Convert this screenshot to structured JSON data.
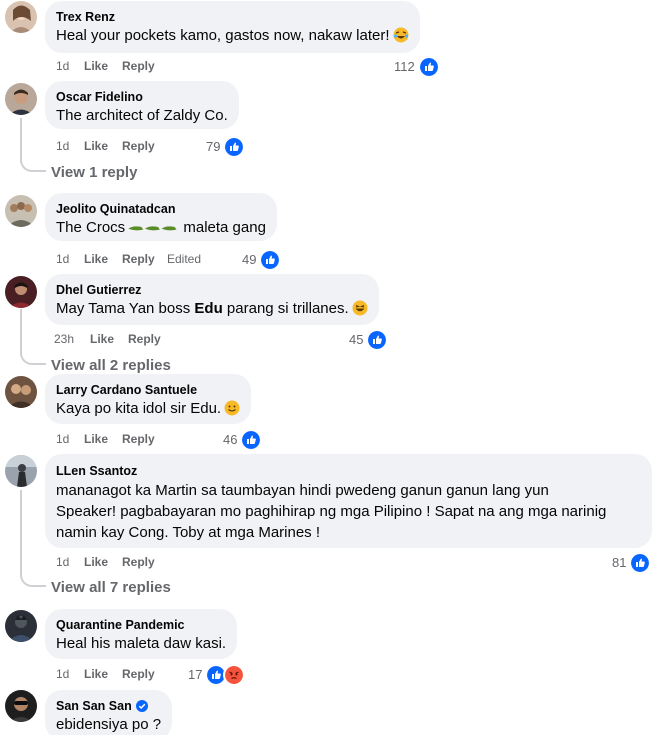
{
  "icons": {
    "like": "like-icon",
    "angry": "angry-icon",
    "verified": "verified-badge-icon"
  },
  "colors": {
    "like_blue": "#0866ff",
    "angry": "#f5533d",
    "bubble": "#f0f2f5",
    "meta_text": "#65676b"
  },
  "actions_labels": {
    "like": "Like",
    "reply": "Reply",
    "edited": "Edited"
  },
  "comments": [
    {
      "author": "Trex Renz",
      "text": "Heal your pockets kamo, gastos now, nakaw later!",
      "emoji": "rofl",
      "time": "1d",
      "reactions": "112"
    },
    {
      "author": "Oscar Fidelino",
      "text": "The architect of Zaldy Co.",
      "time": "1d",
      "reactions": "79",
      "view_replies": "View 1 reply"
    },
    {
      "author": "Jeolito Quinatadcan",
      "text_before": "The Crocs",
      "text_after": " maleta gang",
      "time": "1d",
      "reactions": "49",
      "edited": true
    },
    {
      "author": "Dhel Gutierrez",
      "text_before": "May Tama Yan boss ",
      "text_bold": "Edu",
      "text_after": " parang si trillanes.",
      "emoji": "laugh",
      "time": "23h",
      "reactions": "45",
      "view_replies": "View all 2 replies"
    },
    {
      "author": "Larry Cardano Santuele",
      "text": "Kaya po kita idol sir Edu.",
      "emoji": "smile",
      "time": "1d",
      "reactions": "46"
    },
    {
      "author": "LLen Ssantoz",
      "lines": [
        "mananagot ka Martin sa taumbayan hindi pwedeng ganun ganun lang yun",
        "Speaker! pagbabayaran mo paghihirap ng mga Pilipino ! Sapat na ang mga narinig",
        "namin kay Cong. Toby at mga Marines !"
      ],
      "time": "1d",
      "reactions": "81",
      "view_replies": "View all 7 replies"
    },
    {
      "author": "Quarantine Pandemic",
      "text": "Heal his maleta daw kasi.",
      "time": "1d",
      "reactions": "17"
    },
    {
      "author": "San San San",
      "text": "ebidensiya po ?",
      "verified": true
    }
  ]
}
